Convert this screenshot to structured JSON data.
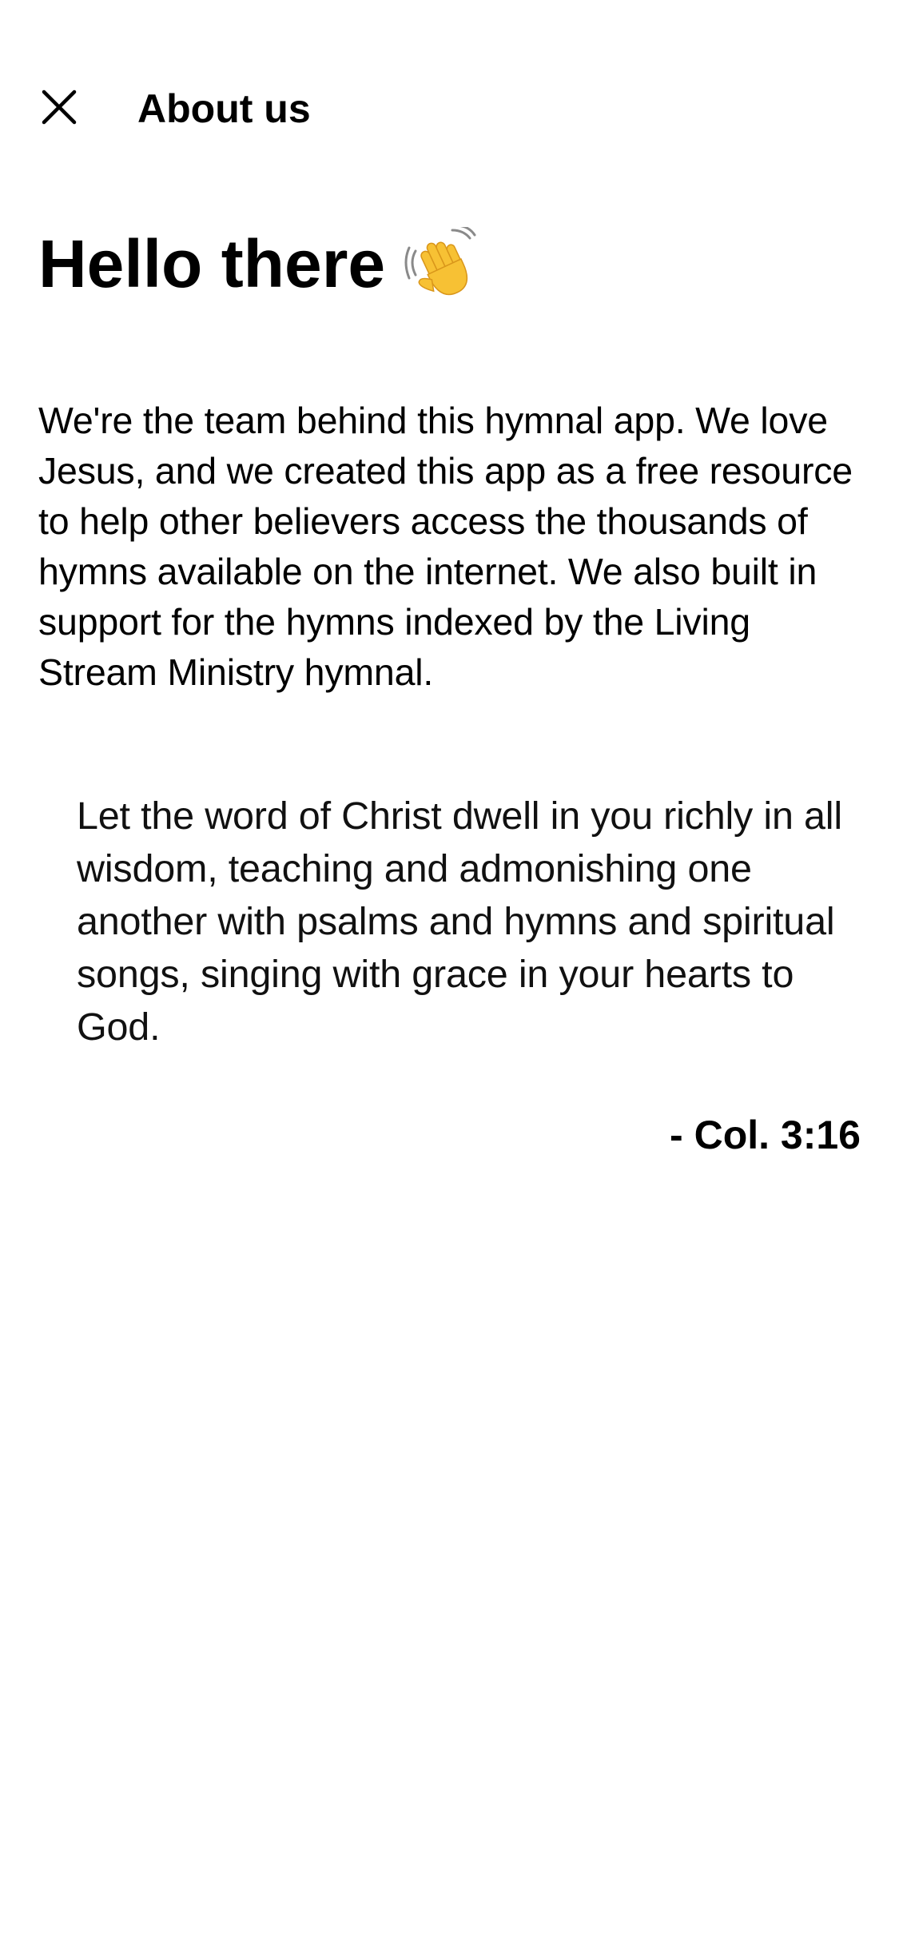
{
  "app_bar": {
    "close_icon": "close-icon",
    "title": "About us"
  },
  "greeting": {
    "text": "Hello there",
    "icon": "waving-hand-icon"
  },
  "intro": {
    "text": "We're the team behind this hymnal app. We love Jesus, and we created this app as a free resource to help other believers access the thousands of hymns available on the internet. We also built in support for the hymns indexed by the Living Stream Ministry hymnal."
  },
  "verse": {
    "text": "Let the word of Christ dwell in you richly in all wisdom, teaching and admonishing one another with psalms and hymns and spiritual songs, singing with grace in your hearts to God.",
    "reference": "- Col. 3:16"
  },
  "colors": {
    "background": "#ffffff",
    "text": "#000000",
    "wave_emoji": "#F7C134"
  }
}
